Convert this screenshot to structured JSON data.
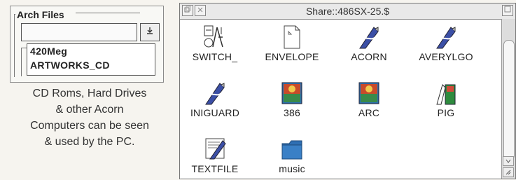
{
  "arch_panel": {
    "title": "Arch Files",
    "dropdown_button": "⭳",
    "options": [
      "420Meg",
      "ARTWORKS_CD"
    ]
  },
  "caption": [
    "CD Roms, Hard Drives",
    "& other Acorn",
    "Computers can be seen",
    "& used by the PC."
  ],
  "filer": {
    "title": "Share::486SX-25.$",
    "files": [
      {
        "name": "SWITCH_",
        "icon": "switch-app-icon"
      },
      {
        "name": "ENVELOPE",
        "icon": "document-icon"
      },
      {
        "name": "ACORN",
        "icon": "drawfile-icon"
      },
      {
        "name": "AVERYLGO",
        "icon": "drawfile-icon"
      },
      {
        "name": "INIGUARD",
        "icon": "drawfile-icon"
      },
      {
        "name": "386",
        "icon": "painting-icon"
      },
      {
        "name": "ARC",
        "icon": "painting-icon"
      },
      {
        "name": "PIG",
        "icon": "image-icon"
      },
      {
        "name": "TEXTFILE",
        "icon": "text-edit-icon"
      },
      {
        "name": "music",
        "icon": "folder-icon"
      }
    ]
  },
  "colors": {
    "folder": "#2f6fb3",
    "drawfile": "#3b4fa6",
    "painting_sky": "#c94b2a",
    "painting_land": "#3a8a4a"
  }
}
